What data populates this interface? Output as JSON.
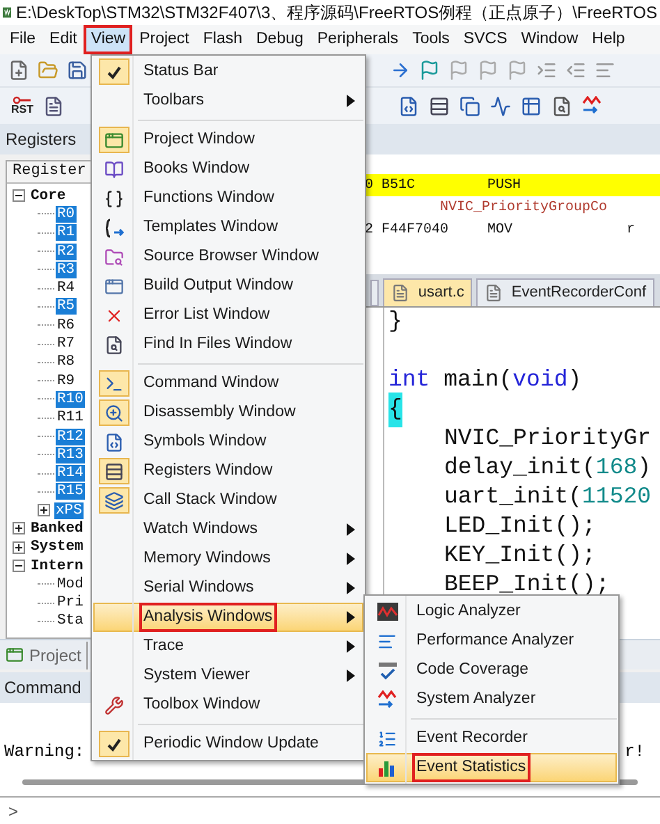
{
  "window": {
    "title": "E:\\DeskTop\\STM32\\STM32F407\\3、程序源码\\FreeRTOS例程（正点原子）\\FreeRTOS"
  },
  "menu_bar": [
    {
      "label": "File",
      "selected": false,
      "annotated": false
    },
    {
      "label": "Edit",
      "selected": false,
      "annotated": false
    },
    {
      "label": "View",
      "selected": true,
      "annotated": true
    },
    {
      "label": "Project",
      "selected": false,
      "annotated": false
    },
    {
      "label": "Flash",
      "selected": false,
      "annotated": false
    },
    {
      "label": "Debug",
      "selected": false,
      "annotated": false
    },
    {
      "label": "Peripherals",
      "selected": false,
      "annotated": false
    },
    {
      "label": "Tools",
      "selected": false,
      "annotated": false
    },
    {
      "label": "SVCS",
      "selected": false,
      "annotated": false
    },
    {
      "label": "Window",
      "selected": false,
      "annotated": false
    },
    {
      "label": "Help",
      "selected": false,
      "annotated": false
    }
  ],
  "toolbar": {
    "reset_label": "RST"
  },
  "registers_panel": {
    "title": "Registers",
    "column": "Register",
    "tree": [
      {
        "label": "Core",
        "expanded": true,
        "children": [
          {
            "label": "R0",
            "highlighted": true
          },
          {
            "label": "R1",
            "highlighted": true
          },
          {
            "label": "R2",
            "highlighted": true
          },
          {
            "label": "R3",
            "highlighted": true
          },
          {
            "label": "R4",
            "highlighted": false
          },
          {
            "label": "R5",
            "highlighted": true
          },
          {
            "label": "R6",
            "highlighted": false
          },
          {
            "label": "R7",
            "highlighted": false
          },
          {
            "label": "R8",
            "highlighted": false
          },
          {
            "label": "R9",
            "highlighted": false
          },
          {
            "label": "R10",
            "highlighted": true
          },
          {
            "label": "R11",
            "highlighted": false
          },
          {
            "label": "R12",
            "highlighted": true
          },
          {
            "label": "R13",
            "highlighted": true
          },
          {
            "label": "R14",
            "highlighted": true
          },
          {
            "label": "R15",
            "highlighted": true
          },
          {
            "label": "xPS",
            "highlighted": true,
            "expanded": false
          }
        ]
      },
      {
        "label": "Banked",
        "expanded": false
      },
      {
        "label": "System",
        "expanded": false
      },
      {
        "label": "Intern",
        "expanded": true,
        "children": [
          {
            "label": "Mod",
            "highlighted": false
          },
          {
            "label": "Pri",
            "highlighted": false
          },
          {
            "label": "Sta",
            "highlighted": false
          }
        ]
      }
    ]
  },
  "disassembly": [
    {
      "kind": "instruction",
      "address": "0 B51C",
      "mnemonic": "PUSH",
      "current": true
    },
    {
      "kind": "source",
      "text": "NVIC_PriorityGroupCo"
    },
    {
      "kind": "instruction",
      "address": "2 F44F7040",
      "mnemonic": "MOV",
      "operand": "r",
      "current": false
    }
  ],
  "editor_tabs": [
    {
      "label": "usart.c",
      "selected": true
    },
    {
      "label": "EventRecorderConf",
      "selected": false
    }
  ],
  "code_lines": [
    {
      "kind": "code",
      "indented": false,
      "brace_match": false,
      "tokens": [
        {
          "text": "}",
          "kind": "plain"
        }
      ]
    },
    {
      "kind": "blank"
    },
    {
      "kind": "code",
      "indented": false,
      "brace_match": false,
      "tokens": [
        {
          "text": "int",
          "kind": "keyword"
        },
        {
          "text": " main(",
          "kind": "plain"
        },
        {
          "text": "void",
          "kind": "keyword"
        },
        {
          "text": ")",
          "kind": "plain"
        }
      ]
    },
    {
      "kind": "code",
      "indented": false,
      "brace_match": true,
      "tokens": [
        {
          "text": "{",
          "kind": "plain"
        }
      ]
    },
    {
      "kind": "code",
      "indented": true,
      "brace_match": false,
      "tokens": [
        {
          "text": "NVIC_PriorityGr",
          "kind": "plain"
        }
      ]
    },
    {
      "kind": "code",
      "indented": true,
      "brace_match": false,
      "tokens": [
        {
          "text": "delay_init(",
          "kind": "plain"
        },
        {
          "text": "168",
          "kind": "number"
        },
        {
          "text": ")",
          "kind": "plain"
        }
      ]
    },
    {
      "kind": "code",
      "indented": true,
      "brace_match": false,
      "tokens": [
        {
          "text": "uart_init(",
          "kind": "plain"
        },
        {
          "text": "11520",
          "kind": "number"
        }
      ]
    },
    {
      "kind": "code",
      "indented": true,
      "brace_match": false,
      "tokens": [
        {
          "text": "LED_Init();",
          "kind": "plain"
        }
      ]
    },
    {
      "kind": "code",
      "indented": true,
      "brace_match": false,
      "tokens": [
        {
          "text": "KEY_Init();",
          "kind": "plain"
        }
      ]
    },
    {
      "kind": "code",
      "indented": true,
      "brace_match": false,
      "tokens": [
        {
          "text": "BEEP_Init();",
          "kind": "plain"
        }
      ]
    }
  ],
  "bottom_tabs": [
    {
      "label": "Project",
      "selected": false
    }
  ],
  "command": {
    "title": "Command",
    "output_start": "Warning:",
    "output_end": "r!",
    "prompt": ">"
  },
  "view_menu": [
    {
      "kind": "item",
      "label": "Status Bar",
      "checked": true,
      "submenu": false,
      "selected": false,
      "annotated": false
    },
    {
      "kind": "item",
      "label": "Toolbars",
      "checked": false,
      "submenu": true,
      "selected": false,
      "annotated": false
    },
    {
      "kind": "separator"
    },
    {
      "kind": "item",
      "label": "Project Window",
      "checked": true,
      "submenu": false,
      "selected": false,
      "annotated": false
    },
    {
      "kind": "item",
      "label": "Books Window",
      "checked": false,
      "submenu": false,
      "selected": false,
      "annotated": false
    },
    {
      "kind": "item",
      "label": "Functions Window",
      "checked": false,
      "submenu": false,
      "selected": false,
      "annotated": false
    },
    {
      "kind": "item",
      "label": "Templates Window",
      "checked": false,
      "submenu": false,
      "selected": false,
      "annotated": false
    },
    {
      "kind": "item",
      "label": "Source Browser Window",
      "checked": false,
      "submenu": false,
      "selected": false,
      "annotated": false
    },
    {
      "kind": "item",
      "label": "Build Output Window",
      "checked": false,
      "submenu": false,
      "selected": false,
      "annotated": false
    },
    {
      "kind": "item",
      "label": "Error List Window",
      "checked": false,
      "submenu": false,
      "selected": false,
      "annotated": false
    },
    {
      "kind": "item",
      "label": "Find In Files Window",
      "checked": false,
      "submenu": false,
      "selected": false,
      "annotated": false
    },
    {
      "kind": "separator"
    },
    {
      "kind": "item",
      "label": "Command Window",
      "checked": true,
      "submenu": false,
      "selected": false,
      "annotated": false
    },
    {
      "kind": "item",
      "label": "Disassembly Window",
      "checked": true,
      "submenu": false,
      "selected": false,
      "annotated": false
    },
    {
      "kind": "item",
      "label": "Symbols Window",
      "checked": false,
      "submenu": false,
      "selected": false,
      "annotated": false
    },
    {
      "kind": "item",
      "label": "Registers Window",
      "checked": true,
      "submenu": false,
      "selected": false,
      "annotated": false
    },
    {
      "kind": "item",
      "label": "Call Stack Window",
      "checked": true,
      "submenu": false,
      "selected": false,
      "annotated": false
    },
    {
      "kind": "item",
      "label": "Watch Windows",
      "checked": false,
      "submenu": true,
      "selected": false,
      "annotated": false
    },
    {
      "kind": "item",
      "label": "Memory Windows",
      "checked": false,
      "submenu": true,
      "selected": false,
      "annotated": false
    },
    {
      "kind": "item",
      "label": "Serial Windows",
      "checked": false,
      "submenu": true,
      "selected": false,
      "annotated": false
    },
    {
      "kind": "item",
      "label": "Analysis Windows",
      "checked": false,
      "submenu": true,
      "selected": true,
      "annotated": true
    },
    {
      "kind": "item",
      "label": "Trace",
      "checked": false,
      "submenu": true,
      "selected": false,
      "annotated": false
    },
    {
      "kind": "item",
      "label": "System Viewer",
      "checked": false,
      "submenu": true,
      "selected": false,
      "annotated": false
    },
    {
      "kind": "item",
      "label": "Toolbox Window",
      "checked": false,
      "submenu": false,
      "selected": false,
      "annotated": false
    },
    {
      "kind": "separator"
    },
    {
      "kind": "item",
      "label": "Periodic Window Update",
      "checked": true,
      "submenu": false,
      "selected": false,
      "annotated": false
    }
  ],
  "analysis_submenu": [
    {
      "kind": "item",
      "label": "Logic Analyzer",
      "selected": false,
      "annotated": false
    },
    {
      "kind": "item",
      "label": "Performance Analyzer",
      "selected": false,
      "annotated": false
    },
    {
      "kind": "item",
      "label": "Code Coverage",
      "selected": false,
      "annotated": false
    },
    {
      "kind": "item",
      "label": "System Analyzer",
      "selected": false,
      "annotated": false
    },
    {
      "kind": "separator"
    },
    {
      "kind": "item",
      "label": "Event Recorder",
      "selected": false,
      "annotated": false
    },
    {
      "kind": "item",
      "label": "Event Statistics",
      "selected": true,
      "annotated": true
    }
  ]
}
